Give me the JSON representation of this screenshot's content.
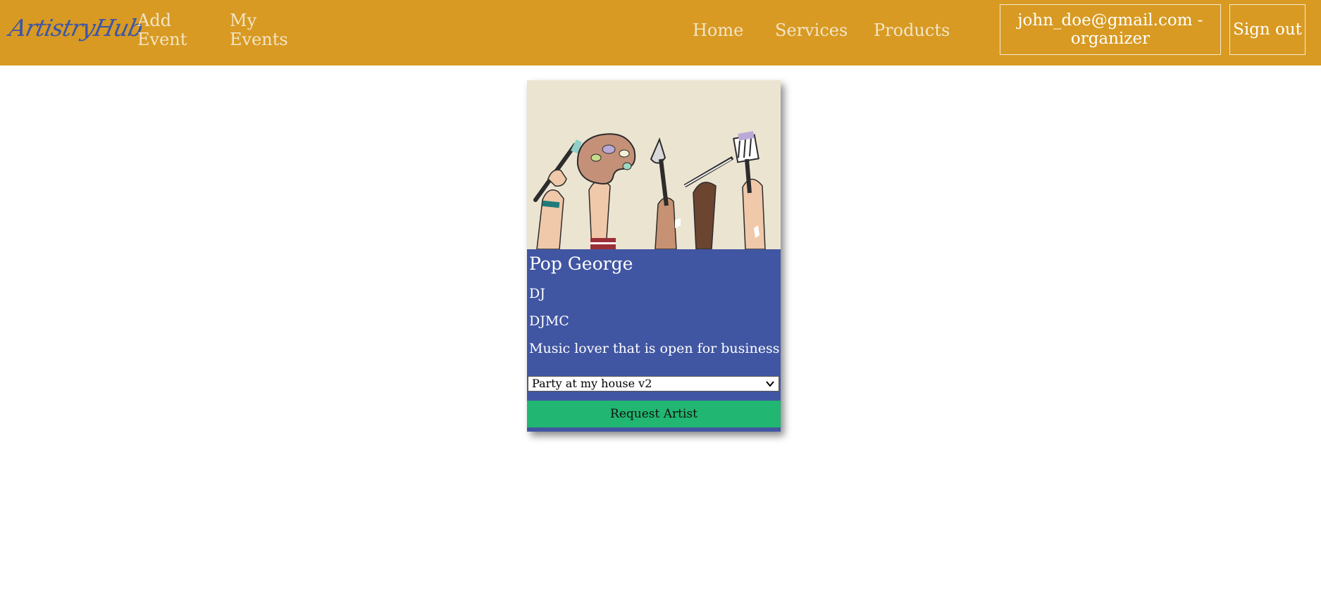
{
  "navbar": {
    "logo": "ArtistryHub",
    "left_links": [
      "Add Event",
      "My Events"
    ],
    "right_links": [
      "Home",
      "Services",
      "Products"
    ],
    "user_label": "john_doe@gmail.com - organizer",
    "signout_label": "Sign out"
  },
  "card": {
    "image_icon": "artist-hands-illustration",
    "name": "Pop George",
    "category": "DJ",
    "subcategory": "DJMC",
    "description": "Music lover that is open for business",
    "event_select": {
      "selected": "Party at my house v2"
    },
    "request_label": "Request Artist"
  },
  "colors": {
    "navbar": "#d89a22",
    "card": "#4156a2",
    "button": "#21b671",
    "logo": "#3b55a8"
  }
}
